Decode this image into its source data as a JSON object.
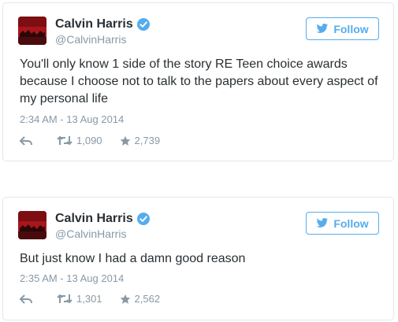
{
  "colors": {
    "link_blue": "#55acee",
    "meta_gray": "#8899a6",
    "text": "#292f33",
    "avatar_red": "#a8161b"
  },
  "tweets": [
    {
      "name": "Calvin Harris",
      "handle": "@CalvinHarris",
      "follow_label": "Follow",
      "text": "You'll only know 1 side of the story RE Teen choice awards because I choose not to talk to the papers about every aspect of my personal life",
      "timestamp": "2:34 AM - 13 Aug 2014",
      "retweets": "1,090",
      "favorites": "2,739",
      "icons": [
        "verified-badge-icon",
        "twitter-bird-icon",
        "reply-icon",
        "retweet-icon",
        "star-icon"
      ]
    },
    {
      "name": "Calvin Harris",
      "handle": "@CalvinHarris",
      "follow_label": "Follow",
      "text": "But just know I had a damn good reason",
      "timestamp": "2:35 AM - 13 Aug 2014",
      "retweets": "1,301",
      "favorites": "2,562",
      "icons": [
        "verified-badge-icon",
        "twitter-bird-icon",
        "reply-icon",
        "retweet-icon",
        "star-icon"
      ]
    }
  ]
}
